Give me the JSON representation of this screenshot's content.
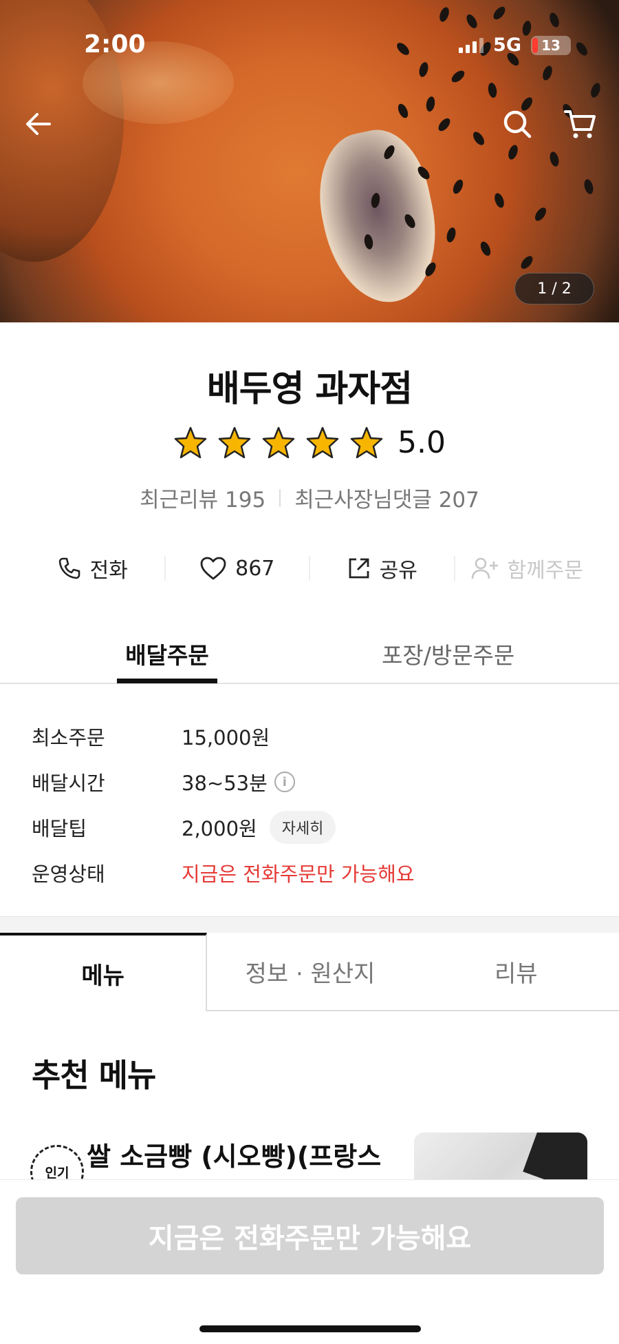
{
  "status_bar": {
    "time": "2:00",
    "network": "5G",
    "battery": "13"
  },
  "hero": {
    "image_counter": "1 / 2"
  },
  "store": {
    "name": "배두영 과자점",
    "rating": "5.0",
    "stars": 5,
    "recent_reviews": "최근리뷰 195",
    "owner_replies": "최근사장님댓글 207"
  },
  "actions": {
    "call": "전화",
    "likes": "867",
    "share": "공유",
    "group_order": "함께주문"
  },
  "order_tabs": {
    "delivery": "배달주문",
    "pickup": "포장/방문주문"
  },
  "info": {
    "min_order_label": "최소주문",
    "min_order_value": "15,000원",
    "delivery_time_label": "배달시간",
    "delivery_time_value": "38~53분",
    "delivery_tip_label": "배달팁",
    "delivery_tip_value": "2,000원",
    "detail_chip": "자세히",
    "status_label": "운영상태",
    "status_value": "지금은 전화주문만 가능해요"
  },
  "menu_tabs": {
    "menu": "메뉴",
    "info": "정보 · 원산지",
    "reviews": "리뷰"
  },
  "recommended": {
    "title": "추천 메뉴",
    "items": [
      {
        "badge": "인기",
        "name": "쌀 소금빵 (시오빵)(프랑스"
      }
    ]
  },
  "bottom": {
    "order_button": "지금은 전화주문만 가능해요"
  }
}
